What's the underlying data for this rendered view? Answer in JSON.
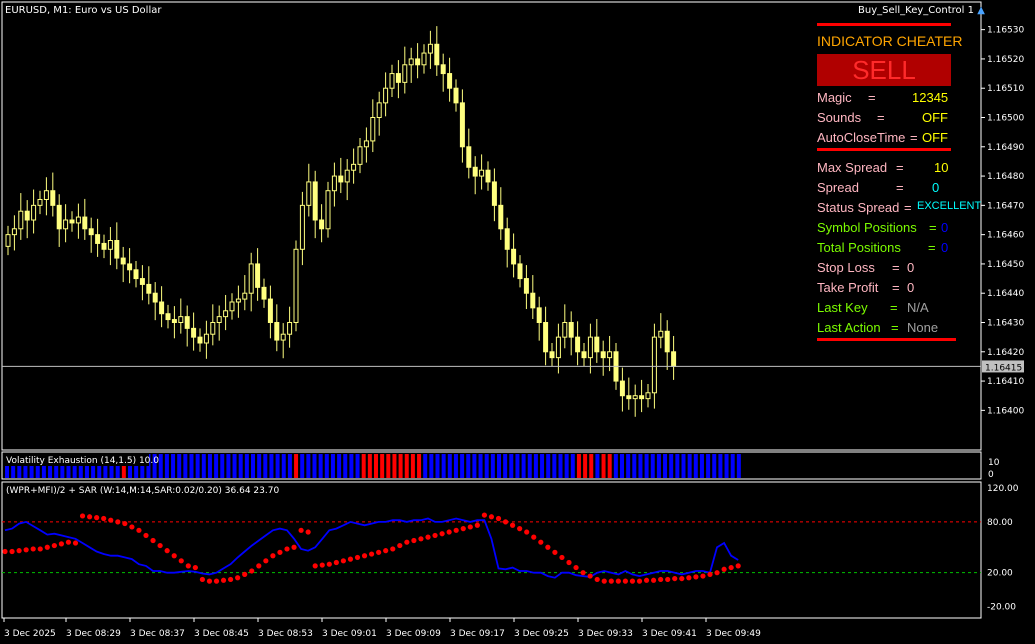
{
  "chart_title": "EURUSD, M1:  Euro vs US Dollar",
  "ea_name": "Buy_Sell_Key_Control 1",
  "ea_icon": "graduation-cap-icon",
  "current_price": "1.16415",
  "colors": {
    "bull": "#ffff80",
    "bear": "#ffff80",
    "panel_red": "#ff0000",
    "title_orange": "#ffa500",
    "label_pink": "#ffb6c1",
    "label_green": "#7cfc00",
    "value_yellow": "#ffff00",
    "value_cyan": "#00ffff",
    "value_blue": "#0000ff",
    "value_gray": "#a0a0a0",
    "ind_blue": "#0000ff",
    "ind_red": "#ff0000",
    "hist_blue": "#0000ff",
    "hist_red": "#ff0000"
  },
  "price_axis": [
    "1.16530",
    "1.16520",
    "1.16510",
    "1.16500",
    "1.16490",
    "1.16480",
    "1.16470",
    "1.16460",
    "1.16450",
    "1.16440",
    "1.16430",
    "1.16420",
    "1.16410",
    "1.16400"
  ],
  "panel": {
    "header": "INDICATOR CHEATER",
    "signal": "SELL",
    "rows": [
      {
        "label": "Magic",
        "eq": "=",
        "value": "12345",
        "label_color": "label_pink",
        "value_color": "value_yellow"
      },
      {
        "label": "Sounds",
        "eq": "=",
        "value": "OFF",
        "label_color": "label_pink",
        "value_color": "value_yellow"
      },
      {
        "label": "AutoCloseTime",
        "eq": "=",
        "value": "OFF",
        "label_color": "label_pink",
        "value_color": "value_yellow"
      },
      {
        "label": "Max Spread",
        "eq": "=",
        "value": "10",
        "label_color": "label_pink",
        "value_color": "value_yellow"
      },
      {
        "label": "Spread",
        "eq": "=",
        "value": "0",
        "label_color": "label_pink",
        "value_color": "value_cyan"
      },
      {
        "label": "Status Spread",
        "eq": "=",
        "value": "EXCELLENT",
        "label_color": "label_pink",
        "value_color": "value_cyan"
      },
      {
        "label": "Symbol Positions",
        "eq": "=",
        "value": "0",
        "label_color": "label_green",
        "value_color": "value_blue"
      },
      {
        "label": "Total Positions",
        "eq": "=",
        "value": "0",
        "label_color": "label_green",
        "value_color": "value_blue"
      },
      {
        "label": "Stop Loss",
        "eq": "=",
        "value": "0",
        "label_color": "label_pink",
        "value_color": "label_pink"
      },
      {
        "label": "Take Profit",
        "eq": "=",
        "value": "0",
        "label_color": "label_pink",
        "value_color": "label_pink"
      },
      {
        "label": "Last Key",
        "eq": "=",
        "value": "N/A",
        "label_color": "label_green",
        "value_color": "value_gray"
      },
      {
        "label": "Last Action",
        "eq": "=",
        "value": "None",
        "label_color": "label_green",
        "value_color": "value_gray"
      }
    ]
  },
  "subwindow1": {
    "title": "Volatility Exhaustion (14,1.5) 10.0",
    "axis": [
      "10",
      "0"
    ]
  },
  "subwindow2": {
    "title": "(WPR+MFI)/2 + SAR (W:14,M:14,SAR:0.02/0.20) 36.64 23.70",
    "axis": [
      "120.00",
      "80.00",
      "20.00",
      "-20.00"
    ]
  },
  "time_axis": [
    "3 Dec 2025",
    "3 Dec 08:29",
    "3 Dec 08:37",
    "3 Dec 08:45",
    "3 Dec 08:53",
    "3 Dec 09:01",
    "3 Dec 09:09",
    "3 Dec 09:17",
    "3 Dec 09:25",
    "3 Dec 09:33",
    "3 Dec 09:41",
    "3 Dec 09:49"
  ],
  "chart_data": {
    "type": "candlestick",
    "symbol": "EURUSD",
    "timeframe": "M1",
    "ylim": [
      1.16395,
      1.16535
    ],
    "close_series": [
      1.1646,
      1.16462,
      1.16468,
      1.16465,
      1.1647,
      1.16472,
      1.16475,
      1.1647,
      1.16462,
      1.16465,
      1.16464,
      1.16466,
      1.16462,
      1.1646,
      1.16457,
      1.16455,
      1.16458,
      1.16452,
      1.1645,
      1.16448,
      1.16445,
      1.16443,
      1.1644,
      1.16437,
      1.16433,
      1.16431,
      1.1643,
      1.16432,
      1.16428,
      1.16425,
      1.16423,
      1.16426,
      1.1643,
      1.16432,
      1.16434,
      1.16437,
      1.16438,
      1.1644,
      1.1645,
      1.16442,
      1.16438,
      1.1643,
      1.16424,
      1.16426,
      1.1643,
      1.16455,
      1.1647,
      1.16478,
      1.16465,
      1.16462,
      1.16475,
      1.1648,
      1.16478,
      1.16482,
      1.16484,
      1.1649,
      1.16492,
      1.165,
      1.16505,
      1.1651,
      1.16515,
      1.16512,
      1.16518,
      1.1652,
      1.16518,
      1.16522,
      1.16525,
      1.16518,
      1.16515,
      1.1651,
      1.16505,
      1.1649,
      1.16483,
      1.1648,
      1.16482,
      1.16478,
      1.1647,
      1.16462,
      1.16455,
      1.1645,
      1.16445,
      1.1644,
      1.16435,
      1.1643,
      1.1642,
      1.16418,
      1.16425,
      1.1643,
      1.16425,
      1.1642,
      1.16418,
      1.16425,
      1.1642,
      1.16418,
      1.1642,
      1.1641,
      1.16405,
      1.16404,
      1.16405,
      1.16404,
      1.16406,
      1.16425,
      1.16427,
      1.1642,
      1.16415
    ],
    "vol_exhaustion_bars": "BBBBBBBBBBBBBBBBBBBRBBBBBBBBBBBBBBBBBBBBBBBBBBBRBBBBBBBBBBRRRRRRRRRRBBBBBBBBBBBBBBBBBBBBBBBBBRRRBRRBBBBBBBBBBBBBBBBBBBBBB",
    "wpr_mfi": [
      70,
      72,
      78,
      80,
      75,
      70,
      65,
      66,
      64,
      62,
      60,
      55,
      50,
      45,
      42,
      40,
      40,
      38,
      36,
      30,
      28,
      22,
      22,
      20,
      20,
      21,
      22,
      21,
      19,
      18,
      20,
      25,
      30,
      38,
      45,
      52,
      58,
      64,
      70,
      72,
      70,
      60,
      48,
      46,
      50,
      60,
      70,
      72,
      76,
      80,
      78,
      76,
      78,
      80,
      80,
      82,
      82,
      80,
      82,
      82,
      84,
      80,
      80,
      82,
      84,
      82,
      80,
      82,
      82,
      60,
      25,
      24,
      26,
      22,
      22,
      20,
      20,
      16,
      14,
      20,
      20,
      17,
      16,
      15,
      20,
      22,
      20,
      18,
      22,
      18,
      16,
      18,
      20,
      22,
      22,
      20,
      18,
      20,
      22,
      22,
      20,
      50,
      55,
      40,
      35
    ],
    "sar": [
      45,
      45,
      46,
      47,
      48,
      48,
      50,
      52,
      54,
      56,
      55,
      87,
      86,
      85,
      84,
      82,
      80,
      78,
      74,
      70,
      64,
      58,
      52,
      46,
      40,
      34,
      28,
      26,
      12,
      10,
      10,
      11,
      12,
      14,
      18,
      22,
      28,
      34,
      40,
      44,
      48,
      50,
      70,
      68,
      28,
      29,
      30,
      32,
      34,
      36,
      38,
      40,
      42,
      44,
      46,
      48,
      52,
      56,
      58,
      60,
      62,
      64,
      66,
      68,
      70,
      72,
      74,
      76,
      88,
      86,
      84,
      80,
      76,
      72,
      68,
      62,
      56,
      50,
      44,
      38,
      32,
      26,
      20,
      16,
      12,
      10,
      10,
      10,
      10,
      10,
      10,
      11,
      11,
      12,
      12,
      13,
      13,
      14,
      15,
      16,
      18,
      20,
      24,
      26,
      28
    ]
  }
}
